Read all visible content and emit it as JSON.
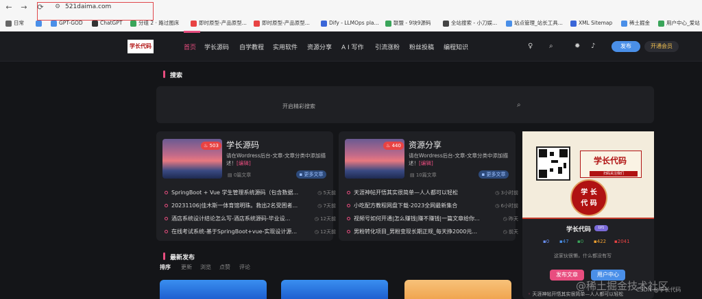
{
  "browser": {
    "url": "521daima.com",
    "bookmarks": [
      {
        "label": "日常",
        "color": "#666"
      },
      {
        "label": "",
        "color": "#4a8fe8"
      },
      {
        "label": "GPT-GOD",
        "color": "#4a8fe8"
      },
      {
        "label": "ChatGPT",
        "color": "#333"
      },
      {
        "label": "分组 2 · 路过图床",
        "color": "#3aa55a"
      },
      {
        "label": "即时原型-产品原型...",
        "color": "#e84343"
      },
      {
        "label": "即时原型-产品原型...",
        "color": "#e84343"
      },
      {
        "label": "Dify - LLMOps pla...",
        "color": "#3a66d8"
      },
      {
        "label": "联盟 - 9块9源码",
        "color": "#3aa55a"
      },
      {
        "label": "全站搜索 - 小刀娱...",
        "color": "#444"
      },
      {
        "label": "站点管理_站长工具...",
        "color": "#4a8fe8"
      },
      {
        "label": "XML Sitemap",
        "color": "#3a66d8"
      },
      {
        "label": "稀土掘金",
        "color": "#4a8fe8"
      },
      {
        "label": "用户中心_爱站",
        "color": "#3aa55a"
      }
    ]
  },
  "header": {
    "logo": "学长代码",
    "nav": [
      "首页",
      "学长源码",
      "自学教程",
      "实用软件",
      "资源分享",
      "A I 写作",
      "引流涨粉",
      "粉丝投稿",
      "编程知识"
    ],
    "publish": "发布",
    "vip": "开通会员"
  },
  "search": {
    "title": "搜索",
    "placeholder": "开启精彩搜索"
  },
  "cards": [
    {
      "title": "学长源码",
      "badge": "503",
      "desc": "请在Wordress后台-文章-文章分类中添加描述！",
      "tag": "[编辑]",
      "count": "0篇文章",
      "more": "更多文章",
      "items": [
        {
          "t": "SpringBoot + Vue 学生管理系统源码（包含数据...",
          "ago": "5天前"
        },
        {
          "t": "20231106|佳木斯一体育馆明珠。救出2名受困者...",
          "ago": "7天前"
        },
        {
          "t": "酒店系统设计结论怎么写-酒店系统源码-毕业设...",
          "ago": "12天前"
        },
        {
          "t": "在线考试系统-基于SpringBoot+vue-实现设计源...",
          "ago": "12天前"
        }
      ]
    },
    {
      "title": "资源分享",
      "badge": "440",
      "desc": "请在Wordress后台-文章-文章分类中添加描述！",
      "tag": "[编辑]",
      "count": "10篇文章",
      "more": "更多文章",
      "items": [
        {
          "t": "天涯神帖开悟其实很简单—人人都可以轻松",
          "ago": "3小时前"
        },
        {
          "t": "小吃配方教程网盘下载-2023全网最新集合",
          "ago": "6小时前"
        },
        {
          "t": "视频号如何开通|怎么赚钱|赚不赚钱|一篇文章给你...",
          "ago": "昨天"
        },
        {
          "t": "男粉转化项目_男粉变现长期正规_每天挣2000元...",
          "ago": "前天"
        }
      ]
    }
  ],
  "sidebar": {
    "poster_title": "学长代码",
    "poster_sub": "扫码关注我们",
    "seal": [
      "学",
      "长",
      "代",
      "码"
    ],
    "name": "学长代码",
    "level": "LV1",
    "stats": [
      {
        "v": "0",
        "color": "#6a8ff0"
      },
      {
        "v": "47",
        "color": "#4a8fe8"
      },
      {
        "v": "0",
        "color": "#3aa55a"
      },
      {
        "v": "422",
        "color": "#f0a030"
      },
      {
        "v": "2041",
        "color": "#e84343"
      }
    ],
    "signature": "这家伙很懒，什么都没有写",
    "btn_post": "发布文章",
    "btn_user": "用户中心",
    "footer": "天涯神帖开悟其实很简单—人人都可以轻松"
  },
  "latest": {
    "title": "最新发布",
    "tabs": [
      "排序",
      "更新",
      "浏览",
      "点赞",
      "评论"
    ]
  },
  "watermark": {
    "main": "@稀土掘金技术社区",
    "sub": "CSDN @学长代码"
  }
}
